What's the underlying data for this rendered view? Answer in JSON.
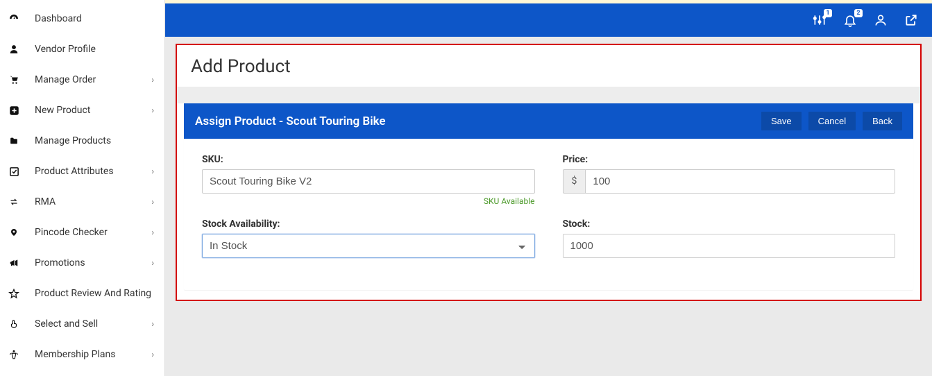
{
  "sidebar": {
    "items": [
      {
        "label": "Dashboard",
        "icon": "dashboard",
        "expandable": false
      },
      {
        "label": "Vendor Profile",
        "icon": "user",
        "expandable": false
      },
      {
        "label": "Manage Order",
        "icon": "cart",
        "expandable": true
      },
      {
        "label": "New Product",
        "icon": "plus-square",
        "expandable": true
      },
      {
        "label": "Manage Products",
        "icon": "folder",
        "expandable": false
      },
      {
        "label": "Product Attributes",
        "icon": "check-square",
        "expandable": true
      },
      {
        "label": "RMA",
        "icon": "exchange",
        "expandable": true
      },
      {
        "label": "Pincode Checker",
        "icon": "map-pin",
        "expandable": true
      },
      {
        "label": "Promotions",
        "icon": "bullhorn",
        "expandable": true
      },
      {
        "label": "Product Review And Rating",
        "icon": "star",
        "expandable": false
      },
      {
        "label": "Select and Sell",
        "icon": "hand-pointer",
        "expandable": true
      },
      {
        "label": "Membership Plans",
        "icon": "person",
        "expandable": true
      }
    ]
  },
  "topbar": {
    "sliders_badge": "1",
    "bell_badge": "2"
  },
  "page": {
    "title": "Add Product",
    "panel_title": "Assign Product - Scout Touring Bike",
    "buttons": {
      "save": "Save",
      "cancel": "Cancel",
      "back": "Back"
    },
    "fields": {
      "sku_label": "SKU:",
      "sku_value": "Scout Touring Bike V2",
      "sku_hint": "SKU Available",
      "price_label": "Price:",
      "price_currency": "$",
      "price_value": "100",
      "stock_avail_label": "Stock Availability:",
      "stock_avail_value": "In Stock",
      "stock_label": "Stock:",
      "stock_value": "1000"
    }
  }
}
